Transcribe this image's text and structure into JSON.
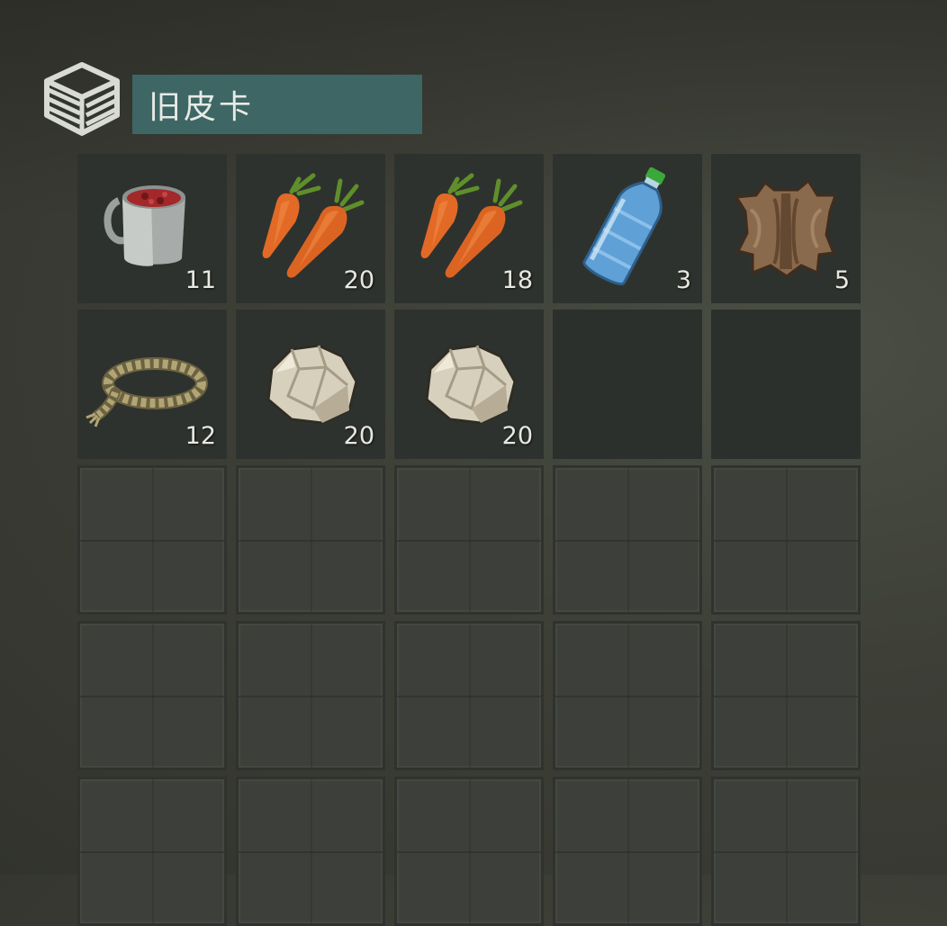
{
  "container": {
    "icon": "storage-crate-icon",
    "title": "旧皮卡"
  },
  "colors": {
    "title_bg": "#3e6664",
    "slot_bg": "#2e322e",
    "locked_slot_bg": "#3d403a",
    "count_text": "#e8e8e2"
  },
  "slots": [
    {
      "item": "berry-soup-mug-icon",
      "count": "11"
    },
    {
      "item": "carrots-icon",
      "count": "20"
    },
    {
      "item": "carrots-icon",
      "count": "18"
    },
    {
      "item": "water-bottle-icon",
      "count": "3"
    },
    {
      "item": "animal-hide-icon",
      "count": "5"
    },
    {
      "item": "rope-icon",
      "count": "12"
    },
    {
      "item": "stone-icon",
      "count": "20"
    },
    {
      "item": "stone-icon",
      "count": "20"
    },
    {
      "item": null,
      "count": ""
    },
    {
      "item": null,
      "count": ""
    }
  ],
  "locked_slot_rows": 3
}
